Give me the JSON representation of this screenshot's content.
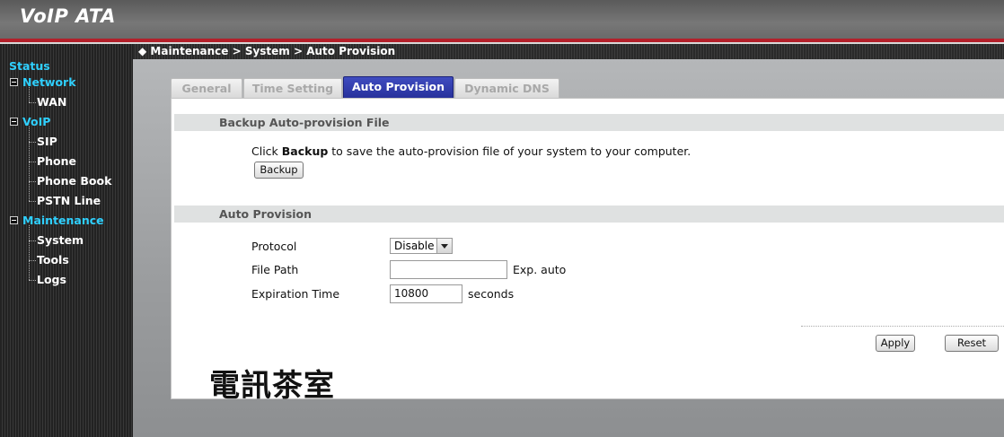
{
  "app": {
    "title": "VoIP ATA"
  },
  "breadcrumb": "◆ Maintenance > System > Auto Provision",
  "sidebar": {
    "status": "Status",
    "network": "Network",
    "wan": "WAN",
    "voip": "VoIP",
    "sip": "SIP",
    "phone": "Phone",
    "phone_book": "Phone Book",
    "pstn_line": "PSTN Line",
    "maintenance": "Maintenance",
    "system": "System",
    "tools": "Tools",
    "logs": "Logs"
  },
  "tabs": [
    "General",
    "Time Setting",
    "Auto Provision",
    "Dynamic DNS"
  ],
  "active_tab": "Auto Provision",
  "backup_section": {
    "title": "Backup Auto-provision File",
    "text_pre": "Click ",
    "text_bold": "Backup",
    "text_post": " to save the auto-provision file of your system to your computer.",
    "button": "Backup"
  },
  "auto_provision": {
    "title": "Auto Provision",
    "protocol_label": "Protocol",
    "protocol_value": "Disable",
    "file_path_label": "File Path",
    "file_path_value": "",
    "file_path_hint": "Exp. auto",
    "expiration_label": "Expiration Time",
    "expiration_value": "10800",
    "expiration_unit": "seconds"
  },
  "actions": {
    "apply": "Apply",
    "reset": "Reset"
  },
  "watermark": "電訊茶室",
  "colors": {
    "accent": "#2fd0ff",
    "active_tab": "#27309a",
    "header_red": "#b3202a"
  }
}
